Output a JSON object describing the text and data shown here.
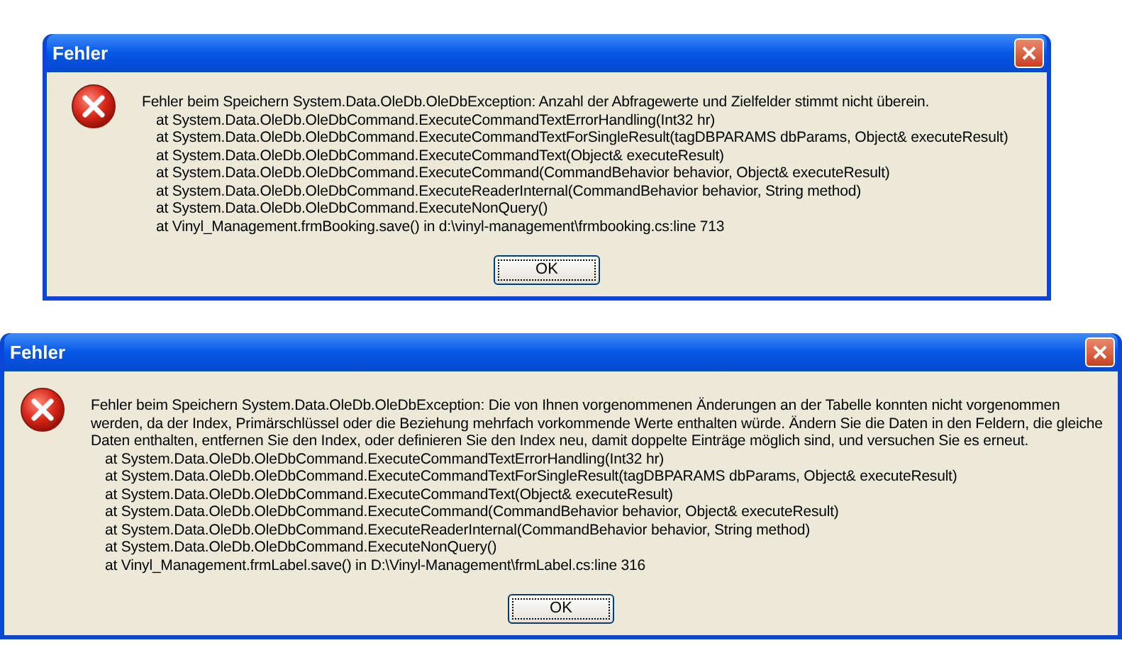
{
  "dialogs": [
    {
      "title": "Fehler",
      "message": "Fehler beim Speichern System.Data.OleDb.OleDbException: Anzahl der Abfragewerte und Zielfelder stimmt nicht überein.",
      "stack": [
        "at System.Data.OleDb.OleDbCommand.ExecuteCommandTextErrorHandling(Int32 hr)",
        "at System.Data.OleDb.OleDbCommand.ExecuteCommandTextForSingleResult(tagDBPARAMS dbParams, Object& executeResult)",
        "at System.Data.OleDb.OleDbCommand.ExecuteCommandText(Object& executeResult)",
        "at System.Data.OleDb.OleDbCommand.ExecuteCommand(CommandBehavior behavior, Object& executeResult)",
        "at System.Data.OleDb.OleDbCommand.ExecuteReaderInternal(CommandBehavior behavior, String method)",
        "at System.Data.OleDb.OleDbCommand.ExecuteNonQuery()",
        "at Vinyl_Management.frmBooking.save() in d:\\vinyl-management\\frmbooking.cs:line 713"
      ],
      "button": "OK"
    },
    {
      "title": "Fehler",
      "message": "Fehler beim Speichern System.Data.OleDb.OleDbException: Die von Ihnen vorgenommenen Änderungen an der Tabelle konnten nicht vorgenommen werden, da der Index, Primärschlüssel oder die Beziehung mehrfach vorkommende Werte enthalten würde. Ändern Sie die Daten in den Feldern, die gleiche Daten enthalten, entfernen Sie den Index, oder definieren Sie den Index neu, damit doppelte Einträge möglich sind, und versuchen Sie es erneut.",
      "stack": [
        "at System.Data.OleDb.OleDbCommand.ExecuteCommandTextErrorHandling(Int32 hr)",
        "at System.Data.OleDb.OleDbCommand.ExecuteCommandTextForSingleResult(tagDBPARAMS dbParams, Object& executeResult)",
        "at System.Data.OleDb.OleDbCommand.ExecuteCommandText(Object& executeResult)",
        "at System.Data.OleDb.OleDbCommand.ExecuteCommand(CommandBehavior behavior, Object& executeResult)",
        "at System.Data.OleDb.OleDbCommand.ExecuteReaderInternal(CommandBehavior behavior, String method)",
        "at System.Data.OleDb.OleDbCommand.ExecuteNonQuery()",
        "at Vinyl_Management.frmLabel.save() in D:\\Vinyl-Management\\frmLabel.cs:line 316"
      ],
      "button": "OK"
    }
  ]
}
